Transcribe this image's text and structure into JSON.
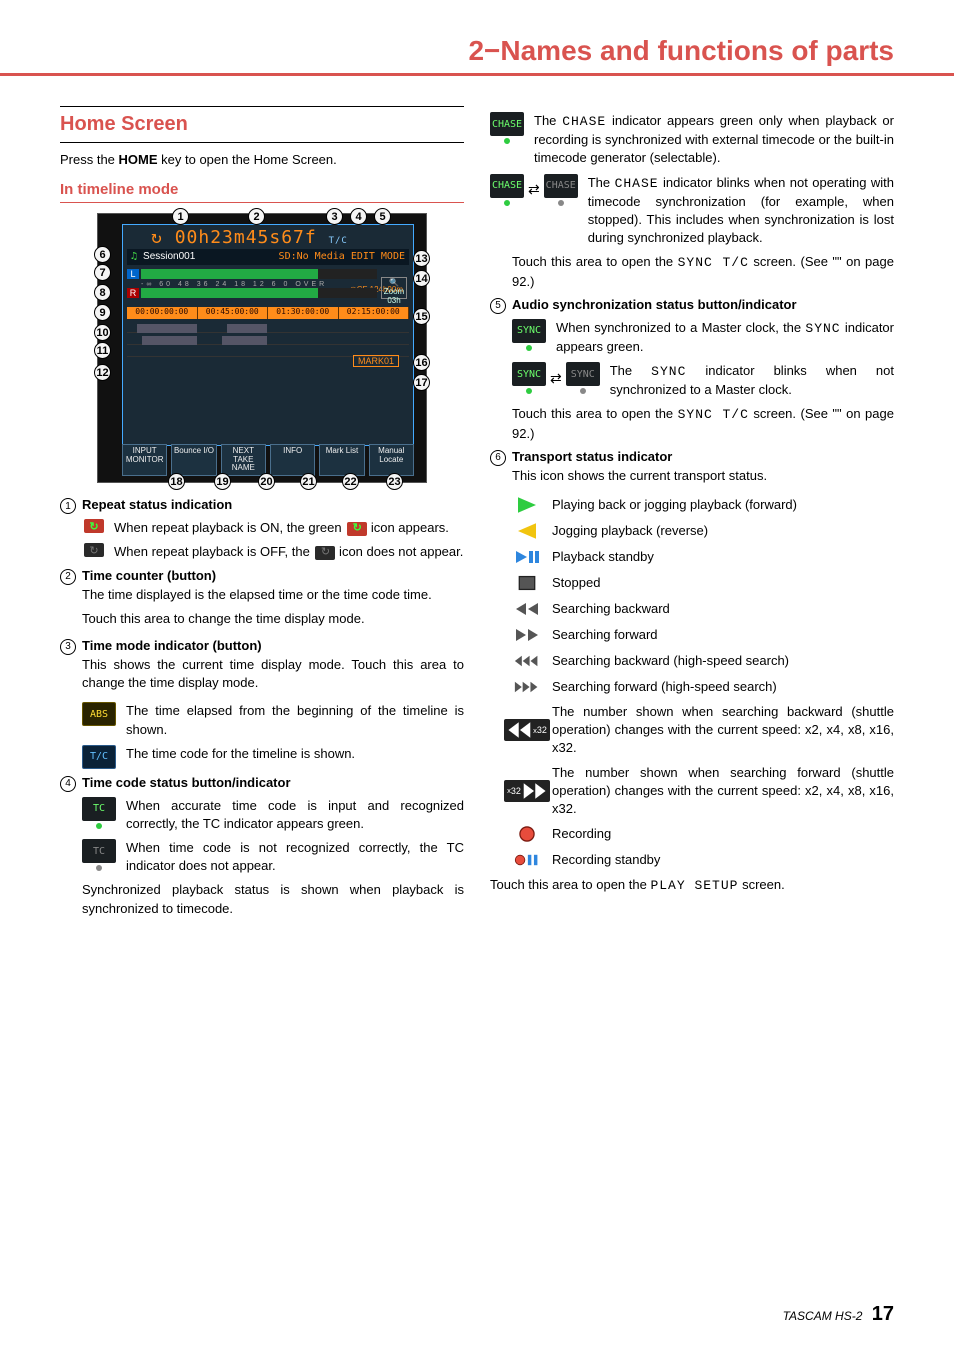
{
  "chapter_title": "2−Names and functions of parts",
  "section_title": "Home Screen",
  "intro": "Press the HOME key to open the Home Screen.",
  "subhead": "In timeline mode",
  "diagram": {
    "counter": "00h23m45s67f",
    "tc_label": "T/C",
    "session_label": "Session001",
    "nomedia": "SD:No Media",
    "edit": "EDIT MODE",
    "cf": "CF 124h00m",
    "ch_l": "L",
    "ch_r": "R",
    "scale": "-∞ 60 48 36 24 18 12 6 0 OVER",
    "zoom": "Zoom 03h",
    "ts1": "00:00:00:00",
    "ts2": "00:45:00:00",
    "ts3": "01:30:00:00",
    "ts4": "02:15:00:00",
    "mark": "MARK01",
    "b1": "INPUT MONITOR",
    "b2": "Bounce I/O",
    "b3": "NEXT TAKE NAME",
    "b4": "INFO",
    "b5": "Mark List",
    "b6": "Manual Locate"
  },
  "callouts": [
    "1",
    "2",
    "3",
    "4",
    "5",
    "6",
    "7",
    "8",
    "9",
    "10",
    "11",
    "12",
    "13",
    "14",
    "15",
    "16",
    "17",
    "18",
    "19",
    "20",
    "21",
    "22",
    "23"
  ],
  "item1": {
    "title": "Repeat status indication",
    "on_text": "When repeat playback is ON, the green ",
    "on_text2": " icon appears.",
    "off_text": "When repeat playback is OFF, the ",
    "off_text2": " icon does not appear."
  },
  "item2": {
    "title": "Time counter (button)",
    "text1": "The time displayed is the elapsed time or the time code time.",
    "text2": "Touch this area to change the time display mode."
  },
  "item3": {
    "title": "Time mode indicator (button)",
    "text1": "This shows the current time display mode. Touch this area to change the time display mode.",
    "abs_chip": "ABS",
    "abs_text": "The time elapsed from the beginning of the timeline is shown.",
    "tc_chip": "T/C",
    "tc_text": "The time code for the timeline is shown."
  },
  "item4": {
    "title": "Time code status button/indicator",
    "tc_label": "TC",
    "row1": "When accurate time code is input and recognized correctly, the TC indicator appears green.",
    "row2": "When time code is not recognized correctly, the TC indicator does not appear.",
    "text_after": "Synchronized playback status is shown when playback is synchronized to timecode.",
    "chase_label": "CHASE",
    "chase_on": "The CHASE indicator appears green only when playback or recording is synchronized with external timecode or the built-in timecode generator (selectable).",
    "chase_blink": "The CHASE indicator blinks when not operating with timecode synchronization (for example, when stopped). This includes when synchronization is lost during synchronized playback.",
    "tail": "Touch this area to open the SYNC T/C screen. (See \"\" on page 92.)",
    "tail_label": "SYNC T/C"
  },
  "item5": {
    "title": "Audio synchronization status button/indicator",
    "sync_label": "SYNC",
    "row1": "When synchronized to a Master clock, the SYNC indicator appears green.",
    "row2": "The SYNC indicator blinks when not synchronized to a Master clock.",
    "tail": "Touch this area to open the SYNC T/C screen. (See \"\" on page 92.)",
    "tail_label": "SYNC T/C"
  },
  "item6": {
    "title": "Transport status indicator",
    "lead": "This icon shows the current transport status.",
    "rows": [
      {
        "svg": "play",
        "t": "Playing back or jogging playback (forward)",
        "col": "#2ecc40"
      },
      {
        "svg": "playrev",
        "t": "Jogging playback (reverse)",
        "col": "#f1c40f"
      },
      {
        "svg": "playstdby",
        "t": "Playback standby",
        "col": "#2e86de"
      },
      {
        "svg": "stop",
        "t": "Stopped",
        "col": "#555"
      },
      {
        "svg": "rew",
        "t": "Searching backward",
        "col": "#555"
      },
      {
        "svg": "ff",
        "t": "Searching forward",
        "col": "#555"
      },
      {
        "svg": "rew3",
        "t": "Searching backward (high-speed search)",
        "col": "#555"
      },
      {
        "svg": "ff3",
        "t": "Searching forward (high-speed search)",
        "col": "#555"
      },
      {
        "svg": "rew32",
        "t": "The number shown when searching backward (shuttle operation) changes with the current speed: x2, x4, x8, x16, x32.",
        "col": "#333"
      },
      {
        "svg": "ff32",
        "t": "The number shown when searching forward (shuttle operation) changes with the current speed: x2, x4, x8, x16, x32.",
        "col": "#333"
      },
      {
        "svg": "rec",
        "t": "Recording",
        "col": "#e74c3c"
      },
      {
        "svg": "recstdby",
        "t": "Recording standby",
        "col": "#e74c3c"
      }
    ],
    "tail": "Touch this area to open the PLAY SETUP screen.",
    "tail_label": "PLAY SETUP"
  },
  "footer_model": "TASCAM HS-2",
  "footer_page": "17"
}
